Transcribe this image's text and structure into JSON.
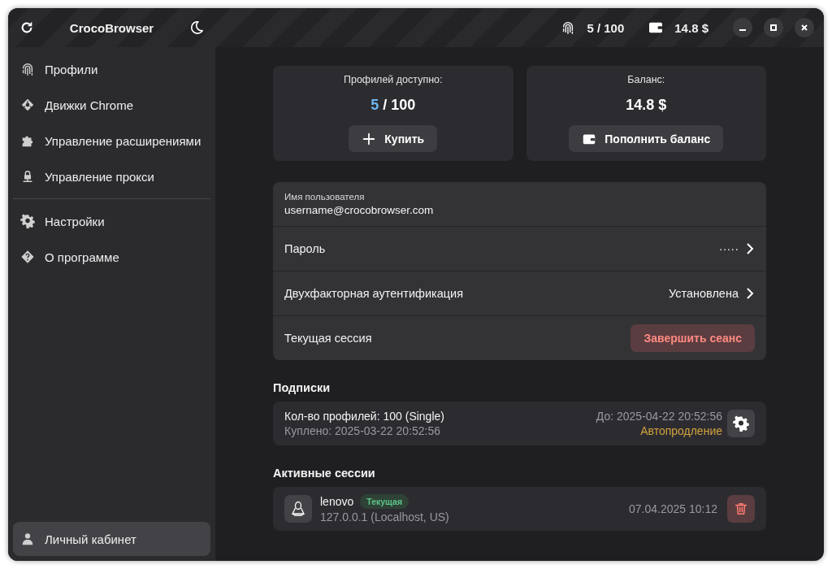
{
  "app": {
    "title": "CrocoBrowser"
  },
  "topbar": {
    "profiles": "5 / 100",
    "balance": "14.8 $"
  },
  "sidebar": {
    "items": [
      {
        "label": "Профили",
        "selected": false
      },
      {
        "label": "Движки Chrome",
        "selected": false
      },
      {
        "label": "Управление расширениями",
        "selected": false
      },
      {
        "label": "Управление прокси",
        "selected": false
      }
    ],
    "secondary_items": [
      {
        "label": "Настройки",
        "selected": false
      },
      {
        "label": "О программе",
        "selected": false
      }
    ],
    "footer_item": {
      "label": "Личный кабинет",
      "selected": true
    }
  },
  "summary": [
    {
      "label": "Профилей доступно:",
      "value_highlight": "5",
      "value": "/ 100",
      "button": "Купить"
    },
    {
      "label": "Баланс:",
      "value": "14.8 $",
      "button": "Пополнить баланс"
    }
  ],
  "account": [
    {
      "kind": "field",
      "label": "Имя пользователя",
      "value": "username@crocobrowser.com"
    },
    {
      "kind": "link",
      "label": "Пароль",
      "value": "·····"
    },
    {
      "kind": "link",
      "label": "Двухфакторная аутентификация",
      "value": "Установлена"
    },
    {
      "kind": "action",
      "label": "Текущая сессия",
      "button": "Завершить сеанс"
    }
  ],
  "subscriptions": {
    "title": "Подписки",
    "items": [
      {
        "name": "Кол-во профилей: 100 (Single)",
        "purchased": "Куплено: 2025-03-22 20:52:56",
        "until": "До: 2025-04-22 20:52:56",
        "renewal": "Автопродление"
      }
    ]
  },
  "sessions": {
    "title": "Активные сессии",
    "items": [
      {
        "device": "lenovo",
        "badge": "Текущая",
        "address": "127.0.0.1 (Localhost, US)",
        "time": "07.04.2025 10:12"
      }
    ]
  }
}
